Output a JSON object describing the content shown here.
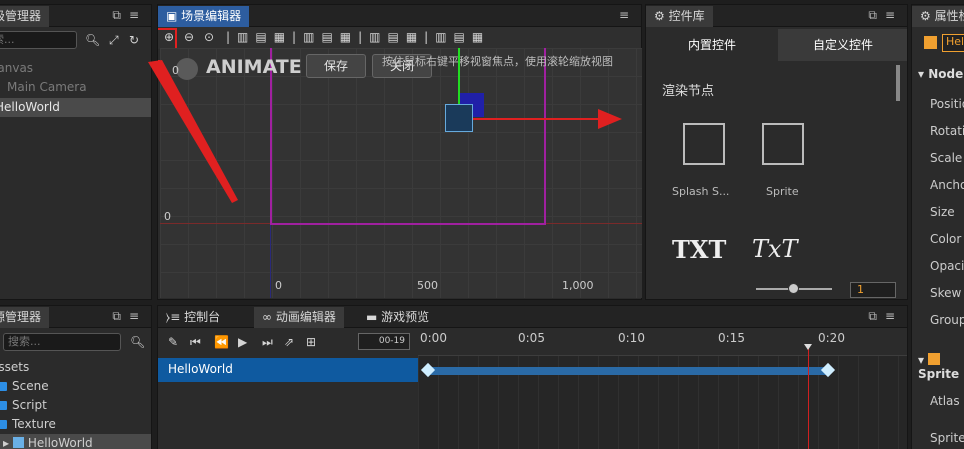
{
  "hierarchy": {
    "title": "层级管理器",
    "search_placeholder": "搜索...",
    "items": [
      "Canvas",
      "Main Camera",
      "HelloWorld"
    ]
  },
  "scene": {
    "title": "场景编辑器",
    "hint": "按住鼠标右键平移视窗焦点，使用滚轮缩放视图",
    "animate_label": "ANIMATE",
    "save_label": "保存",
    "close_label": "关闭",
    "y_axis_labels": [
      "0",
      "0"
    ],
    "x_axis_labels": [
      "0",
      "500",
      "1,000"
    ]
  },
  "widgets": {
    "title": "控件库",
    "tab_builtin": "内置控件",
    "tab_custom": "自定义控件",
    "section": "渲染节点",
    "items": [
      "Splash S...",
      "Sprite"
    ],
    "txt_items": [
      "TXT",
      "TxT"
    ],
    "zoom_value": "1"
  },
  "properties": {
    "title": "属性检查器",
    "node_name": "HelloWorld",
    "node_section": "Node",
    "fields": [
      "Position",
      "Rotation",
      "Scale",
      "Anchor",
      "Size",
      "Color",
      "Opacity",
      "Skew",
      "Group"
    ],
    "sprite_section": "Sprite",
    "sprite_fields": [
      "Atlas",
      "Sprite"
    ]
  },
  "assets": {
    "title": "资源管理器",
    "search_placeholder": "搜索...",
    "items": [
      "assets",
      "Scene",
      "Script",
      "Texture",
      "HelloWorld"
    ]
  },
  "timeline": {
    "tab_console": "控制台",
    "tab_anim": "动画编辑器",
    "tab_preview": "游戏预览",
    "frame": "00-19",
    "track": "HelloWorld",
    "ticks": [
      "0:00",
      "0:05",
      "0:10",
      "0:15",
      "0:20"
    ]
  },
  "colors": {
    "accent": "#2d5d9f",
    "highlight": "#e02020",
    "track": "#0f5aa0",
    "track_bar": "#2a6aa6",
    "frame_border": "#a020a0"
  }
}
